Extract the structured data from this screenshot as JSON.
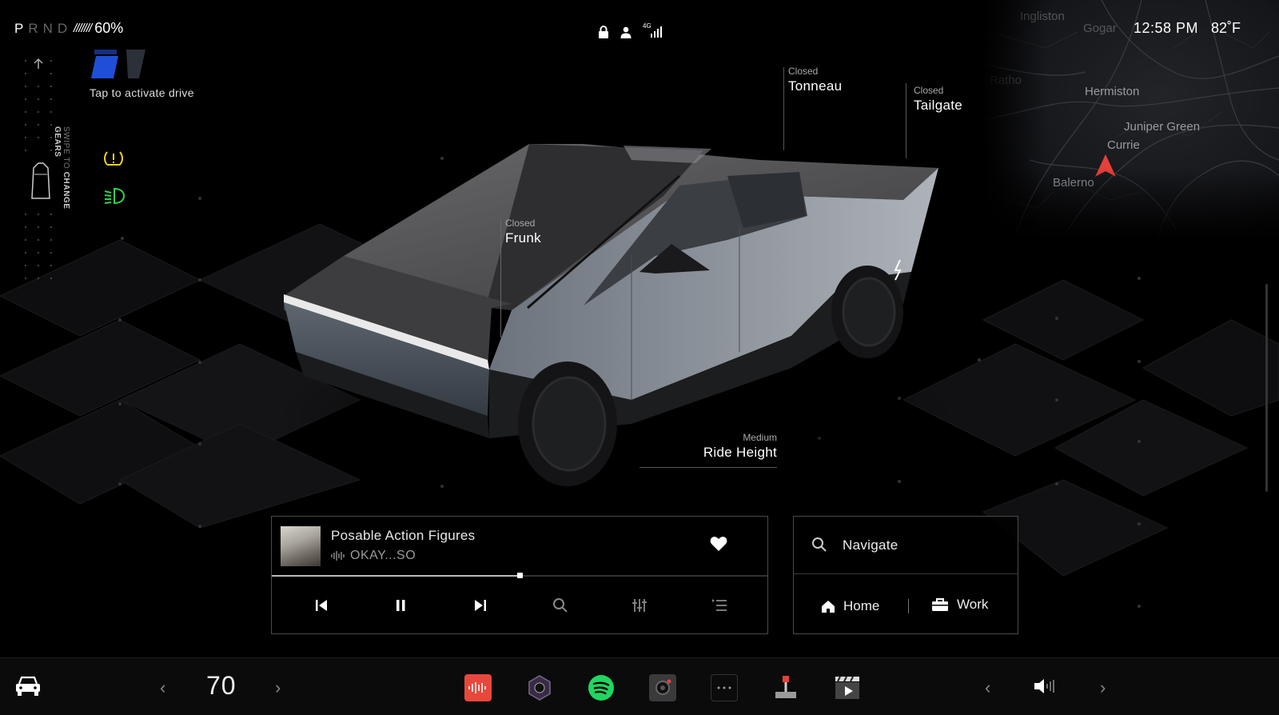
{
  "status": {
    "gears": [
      "P",
      "R",
      "N",
      "D"
    ],
    "active_gear": "P",
    "battery_stripes": "///////",
    "battery_percent": "60%",
    "signal": "4G",
    "time": "12:58 PM",
    "temperature": "82˚F"
  },
  "map": {
    "labels": [
      "Ingliston",
      "Gogar",
      "Ratho",
      "Hermiston",
      "Juniper Green",
      "Currie",
      "Balerno"
    ]
  },
  "drive": {
    "tap_label": "Tap to activate drive",
    "swipe_prefix": "SWIPE TO",
    "swipe_bold": "CHANGE GEARS"
  },
  "callouts": {
    "tonneau": {
      "state": "Closed",
      "name": "Tonneau"
    },
    "tailgate": {
      "state": "Closed",
      "name": "Tailgate"
    },
    "frunk": {
      "state": "Closed",
      "name": "Frunk"
    },
    "ride_height": {
      "state": "Medium",
      "name": "Ride Height"
    }
  },
  "media": {
    "song": "Posable Action Figures",
    "artist": "OKAY...SO",
    "progress": 0.5
  },
  "nav": {
    "navigate_label": "Navigate",
    "home_label": "Home",
    "work_label": "Work"
  },
  "dock": {
    "climate_temp": "70",
    "apps": [
      "voice-memo",
      "camera-lens",
      "spotify",
      "dashcam",
      "more",
      "joystick",
      "theater"
    ]
  },
  "colors": {
    "tpms": "#f5d21c",
    "headlight": "#2fd14a",
    "spotify": "#1ed760",
    "voice_app": "#e8483c",
    "nav_arrow": "#e8403a"
  }
}
